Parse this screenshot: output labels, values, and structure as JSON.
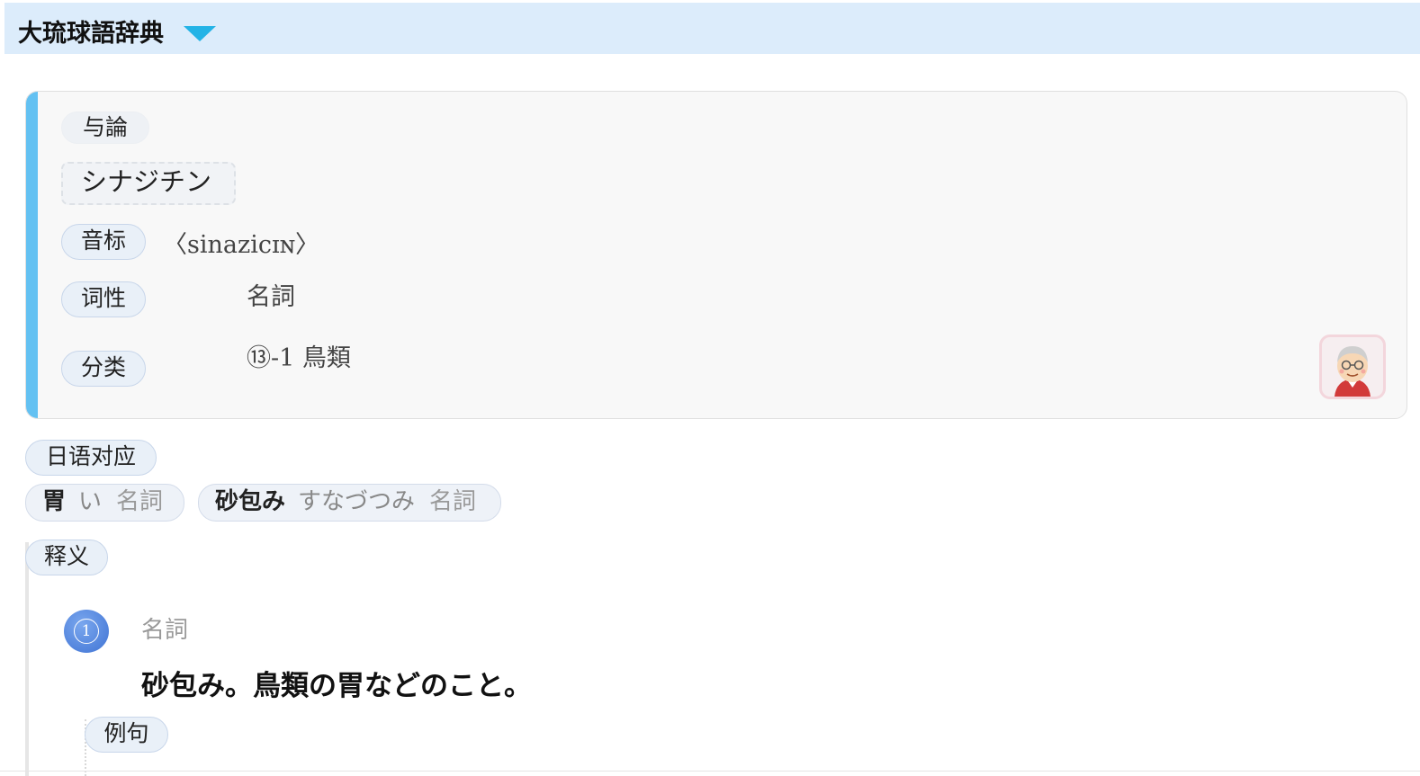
{
  "header": {
    "title": "大琉球語辞典"
  },
  "entry": {
    "dialect": "与論",
    "headword": "シナジチン",
    "pronunciation_label": "音标",
    "pronunciation": "〈sinazicɪɴ〉",
    "pos_label": "词性",
    "pos": "名詞",
    "category_label": "分类",
    "category": "⑬-1 鳥類"
  },
  "japanese": {
    "label": "日语对应",
    "items": [
      {
        "word": "胃",
        "reading": "い",
        "pos": "名詞"
      },
      {
        "word": "砂包み",
        "reading": "すなづつみ",
        "pos": "名詞"
      }
    ]
  },
  "definition": {
    "label": "释义",
    "senses": [
      {
        "number": "1",
        "pos": "名詞",
        "text": "砂包み。鳥類の胃などのこと。",
        "examples_label": "例句"
      }
    ]
  }
}
